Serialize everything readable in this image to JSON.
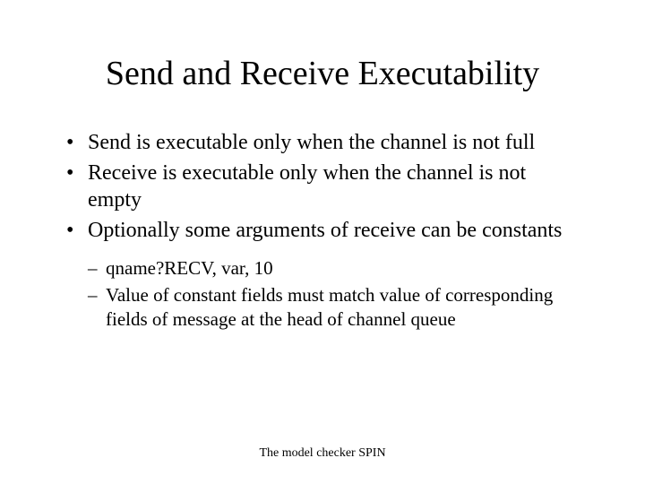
{
  "title": "Send and Receive Executability",
  "bullets": [
    "Send is executable only when the channel is not full",
    "Receive is executable only when the channel is not empty",
    "Optionally some arguments of receive can be constants"
  ],
  "subbullets": [
    "qname?RECV, var, 10",
    "Value of constant fields must match value of corresponding fields of message at the head of channel queue"
  ],
  "footer": "The model checker SPIN"
}
